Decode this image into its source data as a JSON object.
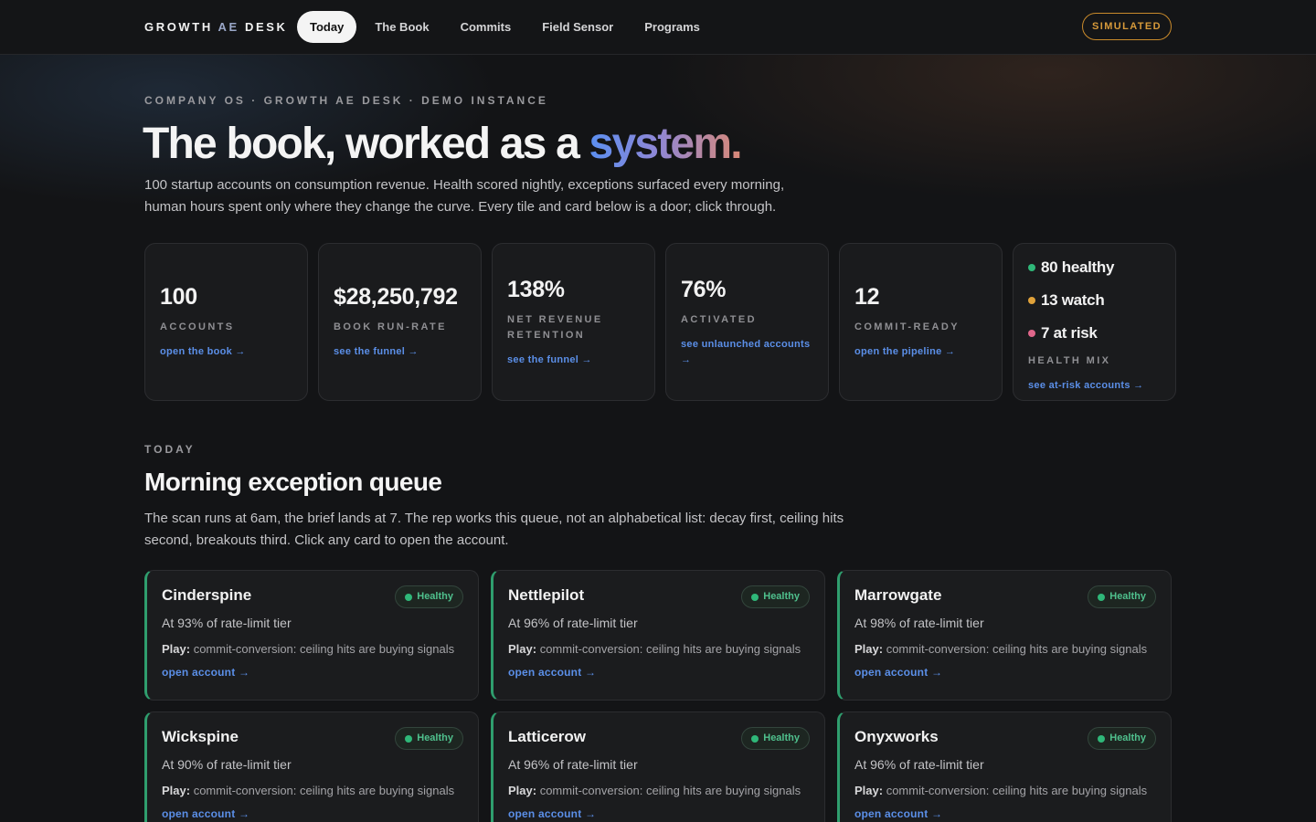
{
  "brand": {
    "part1": "GROWTH",
    "part2": "AE",
    "part3": "DESK"
  },
  "nav": [
    {
      "label": "Today",
      "active": true
    },
    {
      "label": "The Book",
      "active": false
    },
    {
      "label": "Commits",
      "active": false
    },
    {
      "label": "Field Sensor",
      "active": false
    },
    {
      "label": "Programs",
      "active": false
    }
  ],
  "badge": "SIMULATED",
  "hero": {
    "eyebrow": "COMPANY OS · GROWTH AE DESK · DEMO INSTANCE",
    "title_main": "The book, worked as a ",
    "title_accent": "system.",
    "subtitle": "100 startup accounts on consumption revenue. Health scored nightly, exceptions surfaced every morning, human hours spent only where they change the curve. Every tile and card below is a door; click through."
  },
  "stats": [
    {
      "value": "100",
      "label": "ACCOUNTS",
      "link": "open the book →"
    },
    {
      "value": "$28,250,792",
      "label": "BOOK RUN-RATE",
      "link": "see the funnel →"
    },
    {
      "value": "138%",
      "label": "NET REVENUE RETENTION",
      "link": "see the funnel →"
    },
    {
      "value": "76%",
      "label": "ACTIVATED",
      "link": "see unlaunched accounts →"
    },
    {
      "value": "12",
      "label": "COMMIT-READY",
      "link": "open the pipeline →"
    }
  ],
  "health_mix": {
    "healthy": "80 healthy",
    "watch": "13 watch",
    "at_risk": "7 at risk",
    "label": "HEALTH MIX",
    "link": "see at-risk accounts →",
    "colors": {
      "healthy": "#2fb879",
      "watch": "#e0a23a",
      "at_risk": "#e0668a"
    }
  },
  "queue": {
    "eyebrow": "TODAY",
    "title": "Morning exception queue",
    "subtitle": "The scan runs at 6am, the brief lands at 7. The rep works this queue, not an alphabetical list: decay first, ceiling hits second, breakouts third. Click any card to open the account.",
    "play_label": "Play:",
    "cards": [
      {
        "name": "Cinderspine",
        "status": "Healthy",
        "detail": "At 93% of rate-limit tier",
        "play": "commit-conversion: ceiling hits are buying signals",
        "link": "open account →"
      },
      {
        "name": "Nettlepilot",
        "status": "Healthy",
        "detail": "At 96% of rate-limit tier",
        "play": "commit-conversion: ceiling hits are buying signals",
        "link": "open account →"
      },
      {
        "name": "Marrowgate",
        "status": "Healthy",
        "detail": "At 98% of rate-limit tier",
        "play": "commit-conversion: ceiling hits are buying signals",
        "link": "open account →"
      },
      {
        "name": "Wickspine",
        "status": "Healthy",
        "detail": "At 90% of rate-limit tier",
        "play": "commit-conversion: ceiling hits are buying signals",
        "link": "open account →"
      },
      {
        "name": "Latticerow",
        "status": "Healthy",
        "detail": "At 96% of rate-limit tier",
        "play": "commit-conversion: ceiling hits are buying signals",
        "link": "open account →"
      },
      {
        "name": "Onyxworks",
        "status": "Healthy",
        "detail": "At 96% of rate-limit tier",
        "play": "commit-conversion: ceiling hits are buying signals",
        "link": "open account →"
      }
    ]
  }
}
